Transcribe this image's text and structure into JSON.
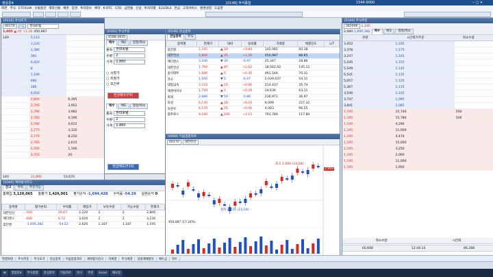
{
  "titlebar": {
    "left": "영웅문4",
    "center": "[0148] 주식종합",
    "right": "1544-9000"
  },
  "menu": [
    "화면",
    "주식",
    "ETF/ELW",
    "선물옵션",
    "해외선물",
    "채권",
    "증권",
    "투자정보",
    "예약",
    "K-OTC",
    "CFD",
    "금현물",
    "신용",
    "투자자별",
    "ELS/DLS",
    "연금",
    "고객서비스",
    "환경설정",
    "도움말"
  ],
  "win_order": {
    "title": "[0101] 주식주문",
    "code": "00170",
    "name": "현대로템",
    "tabs": [
      "매수",
      "매도",
      "정정/취소"
    ],
    "account": "4588-2835",
    "order_rows": [
      {
        "label": "종목",
        "value": "현대로템"
      },
      {
        "label": "수량",
        "value": "2"
      },
      {
        "label": "가격",
        "value": "2,880"
      }
    ],
    "buy_button": "현금매수(F9)",
    "sell_button": "현금매도(F10)",
    "options": [
      "시장가",
      "지정가",
      "조건부"
    ]
  },
  "win_order_book": {
    "title": "[0112] 주식호가",
    "code": "00170",
    "price": "2,800",
    "change": "▲ 10",
    "rate": "+1.26",
    "volume": "450,987",
    "asks": [
      {
        "qty": "140",
        "price": "5,143"
      },
      {
        "qty": "",
        "price": "3,220"
      },
      {
        "qty": "",
        "price": "1,386"
      },
      {
        "qty": "",
        "price": "391"
      },
      {
        "qty": "",
        "price": "6,420"
      },
      {
        "qty": "",
        "price": "8"
      },
      {
        "qty": "",
        "price": "1,190"
      },
      {
        "qty": "",
        "price": "660"
      },
      {
        "qty": "",
        "price": "180"
      },
      {
        "qty": "",
        "price": "4,916"
      }
    ],
    "bids": [
      {
        "price": "2,800",
        "qty": "6,395"
      },
      {
        "price": "2,795",
        "qty": "3,952"
      },
      {
        "price": "2,790",
        "qty": "3,982"
      },
      {
        "price": "2,785",
        "qty": "4,190"
      },
      {
        "price": "2,780",
        "qty": "4,915"
      },
      {
        "price": "2,775",
        "qty": "3,120"
      },
      {
        "price": "2,770",
        "qty": "8,250"
      },
      {
        "price": "2,765",
        "qty": "2,615"
      },
      {
        "price": "2,760",
        "qty": "1,190"
      },
      {
        "price": "2,755",
        "qty": "20"
      }
    ],
    "footer": {
      "left": "140",
      "center": "31,895",
      "right": "53,670"
    }
  },
  "win_watch": {
    "title": "[0130] 관심종목",
    "tabs": [
      "관심종목",
      "주식"
    ],
    "columns": [
      "종목명",
      "현재가",
      "대비",
      "등락률",
      "거래량",
      "체결강도",
      "L/T"
    ],
    "rows": [
      {
        "name": "휴먼엔",
        "price": "1,195",
        "chg": "10",
        "rate": "+0.84",
        "vol": "145,085",
        "str": "60.38"
      },
      {
        "name": "대한전선",
        "price": "2,800",
        "chg": "35",
        "rate": "+1.26",
        "vol": "450,987",
        "str": "88.85"
      },
      {
        "name": "메디엔스",
        "price": "3,240",
        "chg": "30",
        "rate": "-0.97",
        "vol": "25,347",
        "str": "28.86"
      },
      {
        "name": "대한전선",
        "price": "1,760",
        "chg": "45",
        "rate": "+2.62",
        "vol": "18,562,92",
        "str": "145.12"
      },
      {
        "name": "송이테트",
        "price": "1,690",
        "chg": "5",
        "rate": "+0.31",
        "vol": "491,546",
        "str": "70.31"
      },
      {
        "name": "코오",
        "price": "1,045",
        "chg": "5",
        "rate": "-0.47",
        "vol": "2,039,037",
        "str": "54.31"
      },
      {
        "name": "대양금속",
        "price": "3,155",
        "chg": "25",
        "rate": "+0.81",
        "vol": "214,437",
        "str": "35.74"
      },
      {
        "name": "제엔비아오",
        "price": "1,710",
        "chg": "5",
        "rate": "+0.29",
        "vol": "24,630",
        "str": "63.11"
      },
      {
        "name": "빅텍",
        "price": "2,080",
        "chg": "50",
        "rate": "-0.86",
        "vol": "236,971",
        "str": "36.97"
      },
      {
        "name": "덕성",
        "price": "6,130",
        "chg": "10",
        "rate": "+0.16",
        "vol": "8,099",
        "str": "227.32"
      },
      {
        "name": "덕성우",
        "price": "6,170",
        "chg": "25",
        "rate": "+0.41",
        "vol": "4,003",
        "str": "96.55"
      },
      {
        "name": "컴트로스",
        "price": "9,160",
        "chg": "200",
        "rate": "+3.15",
        "vol": "793,789",
        "str": "117.80"
      }
    ]
  },
  "win_chart": {
    "title": "[0600] 키움종합차트",
    "code": "00170",
    "name": "대한전선",
    "high_label": "최고 2,880 (11/28)",
    "low_label": "최저 2,235 (11/19)",
    "price_tag": "2,800",
    "volume_label": "450,987 (17.24%)"
  },
  "win_balance": {
    "title": "[0345] 계좌평가잔고",
    "tabs": [
      "잔고",
      "수익",
      "주문가능"
    ],
    "summary": [
      {
        "label": "총매입",
        "value": "3,120,065"
      },
      {
        "label": "총평가",
        "value": "1,426,001"
      },
      {
        "label": "평가손익",
        "value": "-1,694,428"
      },
      {
        "label": "수익률",
        "value": "-54.29"
      },
      {
        "label": "실현손익",
        "value": "0"
      }
    ],
    "columns": [
      "종목명",
      "평가손익",
      "수익률",
      "매입가",
      "보유수량",
      "가능수량",
      "현재가"
    ],
    "rows": [
      {
        "name": "대한전선",
        "pl": "548",
        "rate": "10.67",
        "buy": "2,220",
        "qty": "2",
        "avail": "2",
        "cur": "2,800"
      },
      {
        "name": "메디엔스",
        "pl": "440",
        "rate": "6.72",
        "buy": "3,020",
        "qty": "2",
        "avail": "2",
        "cur": "3,230"
      },
      {
        "name": "휴먼엔",
        "pl": "-1,695,382",
        "rate": "-54.52",
        "buy": "2,620",
        "qty": "1,187",
        "avail": "1,187",
        "cur": "1,195"
      }
    ]
  },
  "win_right_order": {
    "title": "[0104] 주식주문",
    "code": "282690",
    "price": "1,195",
    "ask_total": "2,680",
    "bid_total": "1,695,382",
    "tabs": [
      "매수",
      "매도",
      "정정/취소"
    ],
    "book_header": {
      "left": "잔량",
      "center": "시간외가주문",
      "right": "취소수량"
    },
    "book_prices": [
      "3,452",
      "3,378",
      "3,247",
      "5,245",
      "5,549",
      "6,541",
      "5,057",
      "5,367",
      "3,546",
      "3,747",
      "3,841"
    ],
    "book_right": [
      "1,185",
      "1,175",
      "1,165",
      "1,155",
      "1,145",
      "1,135",
      "1,125",
      "1,115",
      "1,105",
      "1,095",
      "1,085"
    ],
    "bid_rows": [
      {
        "price": "1,195",
        "qty": "15,740",
        "right": "500"
      },
      {
        "price": "1,195",
        "qty": "15,780",
        "right": "500"
      },
      {
        "price": "1,195",
        "qty": "4,290",
        "right": ""
      },
      {
        "price": "1,195",
        "qty": "11,000",
        "right": ""
      },
      {
        "price": "1,195",
        "qty": "4,470",
        "right": ""
      },
      {
        "price": "1,195",
        "qty": "15,000",
        "right": ""
      },
      {
        "price": "1,195",
        "qty": "3,250",
        "right": ""
      },
      {
        "price": "1,195",
        "qty": "2,000",
        "right": ""
      },
      {
        "price": "1,195",
        "qty": "11,000",
        "right": ""
      },
      {
        "price": "1,195",
        "qty": "1,950",
        "right": ""
      }
    ],
    "footer": {
      "left": "60,668",
      "center": "12:44:14",
      "right": "86,288"
    },
    "footer_labels": [
      "취소수량",
      "시간외"
    ]
  },
  "quickbar": [
    "연결화면",
    "주식주문",
    "주식호가",
    "관심종목",
    "키움종합차트",
    "계좌평가잔고",
    "미체결",
    "주식체결",
    "당일매매일지",
    "예수금",
    "차트"
  ],
  "taskbar": [
    "영웅문4",
    "주식종합",
    "관심종목",
    "키움차트",
    "잔고",
    "주문",
    "Excel",
    "메모장"
  ],
  "colors": {
    "up": "#e0261b",
    "down": "#1c4fd0",
    "accent": "#3a5f92"
  }
}
